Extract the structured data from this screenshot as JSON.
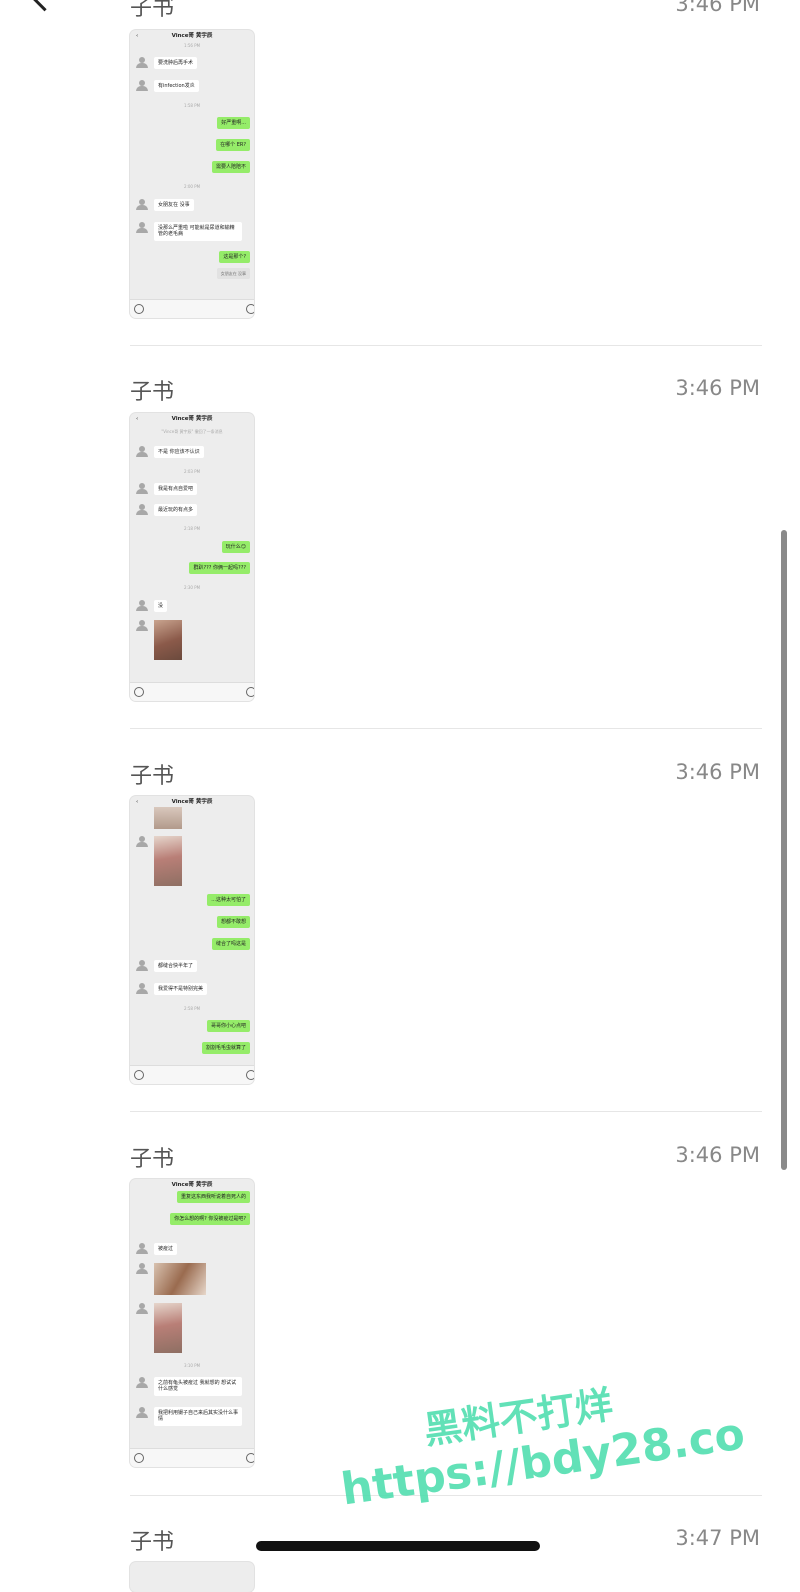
{
  "nav": {
    "back_icon": "chevron-left-icon"
  },
  "messages": [
    {
      "sender": "子书",
      "time": "3:46 PM",
      "thumb": {
        "title": "Vince哥 黄宇辰",
        "items": [
          {
            "type": "ts",
            "text": "1:56 PM"
          },
          {
            "type": "in",
            "text": "要洗肿后再手术"
          },
          {
            "type": "in",
            "text": "有infection发炎"
          },
          {
            "type": "ts",
            "text": "1:58 PM"
          },
          {
            "type": "out",
            "text": "好严重啊..."
          },
          {
            "type": "out",
            "text": "在哪个 ER?"
          },
          {
            "type": "out",
            "text": "需要人陪陪不"
          },
          {
            "type": "ts",
            "text": "2:00 PM"
          },
          {
            "type": "in",
            "text": "女朋友在 没事"
          },
          {
            "type": "in",
            "text": "没那么严重啦 可能就是尿道和输精管的老毛病"
          },
          {
            "type": "out",
            "text": "这是那个?"
          },
          {
            "type": "quote",
            "text": "女朋友在 没事"
          }
        ]
      }
    },
    {
      "sender": "子书",
      "time": "3:46 PM",
      "thumb": {
        "title": "Vince哥 黄宇辰",
        "subtitle": "\"Vince哥 黄宇辰\" 撤回了一条消息",
        "items": [
          {
            "type": "in",
            "text": "不是 你应该不认识"
          },
          {
            "type": "ts",
            "text": "2:03 PM"
          },
          {
            "type": "in",
            "text": "我是有点自爱吧"
          },
          {
            "type": "in",
            "text": "最近玩的有点多"
          },
          {
            "type": "ts",
            "text": "2:18 PM"
          },
          {
            "type": "out",
            "text": "玩什么😏"
          },
          {
            "type": "out",
            "text": "群趴??? 你俩一起吗???"
          },
          {
            "type": "ts",
            "text": "2:30 PM"
          },
          {
            "type": "in",
            "text": "没"
          }
        ]
      }
    },
    {
      "sender": "子书",
      "time": "3:46 PM",
      "thumb": {
        "title": "Vince哥 黄宇辰",
        "items": [
          {
            "type": "out",
            "text": "...这种太可怕了"
          },
          {
            "type": "out",
            "text": "想都不敢想"
          },
          {
            "type": "out",
            "text": "缝合了吗这是"
          },
          {
            "type": "in",
            "text": "都缝合快半年了"
          },
          {
            "type": "in",
            "text": "我爱得不是特别完美"
          },
          {
            "type": "ts",
            "text": "2:58 PM"
          },
          {
            "type": "out",
            "text": "哥哥你小心点吧"
          },
          {
            "type": "out",
            "text": "割割毛毛虫就算了"
          }
        ]
      }
    },
    {
      "sender": "子书",
      "time": "3:46 PM",
      "thumb": {
        "title": "Vince哥 黄宇辰",
        "items": [
          {
            "type": "out",
            "text": "重复这东西我听说着自死人的"
          },
          {
            "type": "out",
            "text": "你怎么想的啊? 你没被疫过是吧?"
          },
          {
            "type": "in",
            "text": "被疫过"
          },
          {
            "type": "ts",
            "text": "3:10 PM"
          },
          {
            "type": "in",
            "text": "之前有龟头被疫过 我就想的 想试试什么感觉"
          },
          {
            "type": "in",
            "text": "我把利用镊子自己来后其实没什么事情"
          }
        ]
      }
    },
    {
      "sender": "子书",
      "time": "3:47 PM"
    }
  ],
  "watermark": {
    "line1": "黑料不打烊",
    "line2": "https://bdy28.co"
  }
}
